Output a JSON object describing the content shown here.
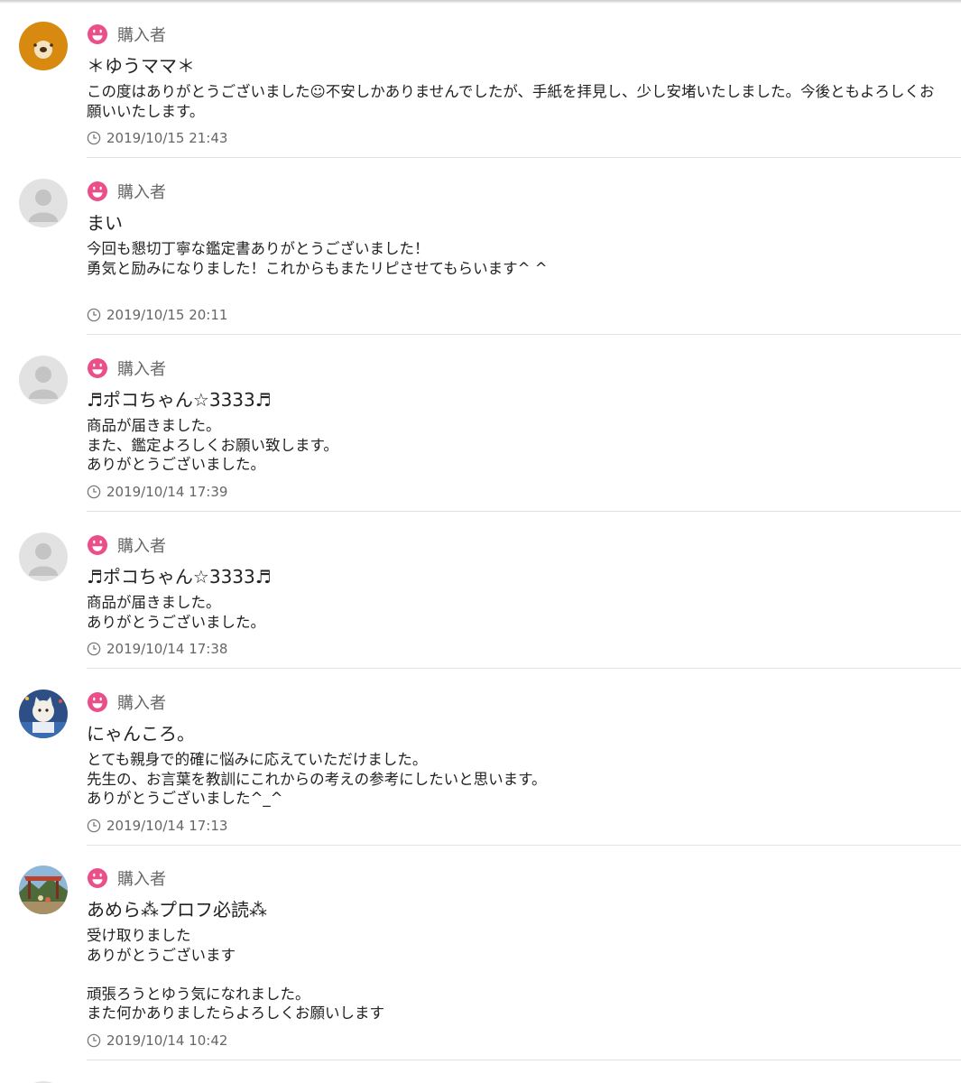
{
  "role_label": "購入者",
  "icons": {
    "role": "smiley-face-icon",
    "date": "clock-icon"
  },
  "colors": {
    "accent_pink": "#ea4f89",
    "muted_text": "#666666",
    "separator": "#e3e3e3",
    "default_avatar": "#e2e2e2"
  },
  "reviews": [
    {
      "avatar": "bear-avatar",
      "name": "＊ゆうママ＊",
      "body": "この度はありがとうございました☺不安しかありませんでしたが、手紙を拝見し、少し安堵いたしました。今後ともよろしくお願いいたします。",
      "date": "2019/10/15 21:43"
    },
    {
      "avatar": "default-avatar",
      "name": "まい",
      "body": "今回も懇切丁寧な鑑定書ありがとうございました！\n勇気と励みになりました！これからもまたリピさせてもらいます^ ^",
      "date": "2019/10/15 20:11"
    },
    {
      "avatar": "default-avatar",
      "name": "♬ポコちゃん☆3333♬",
      "body": "商品が届きました。\nまた、鑑定よろしくお願い致します。\nありがとうございました。",
      "date": "2019/10/14 17:39"
    },
    {
      "avatar": "default-avatar",
      "name": "♬ポコちゃん☆3333♬",
      "body": "商品が届きました。\nありがとうございました。",
      "date": "2019/10/14 17:38"
    },
    {
      "avatar": "cat-photo-avatar",
      "name": "にゃんころ。",
      "body": "とても親身で的確に悩みに応えていただけました。\n先生の、お言葉を教訓にこれからの考えの参考にしたいと思います。\nありがとうございました^_^",
      "date": "2019/10/14 17:13"
    },
    {
      "avatar": "landscape-photo-avatar",
      "name": "あめら⁂プロフ必読⁂",
      "body": "受け取りました\nありがとうございます\n\n頑張ろうとゆう気になれました。\nまた何かありましたらよろしくお願いします",
      "date": "2019/10/14 10:42"
    }
  ]
}
